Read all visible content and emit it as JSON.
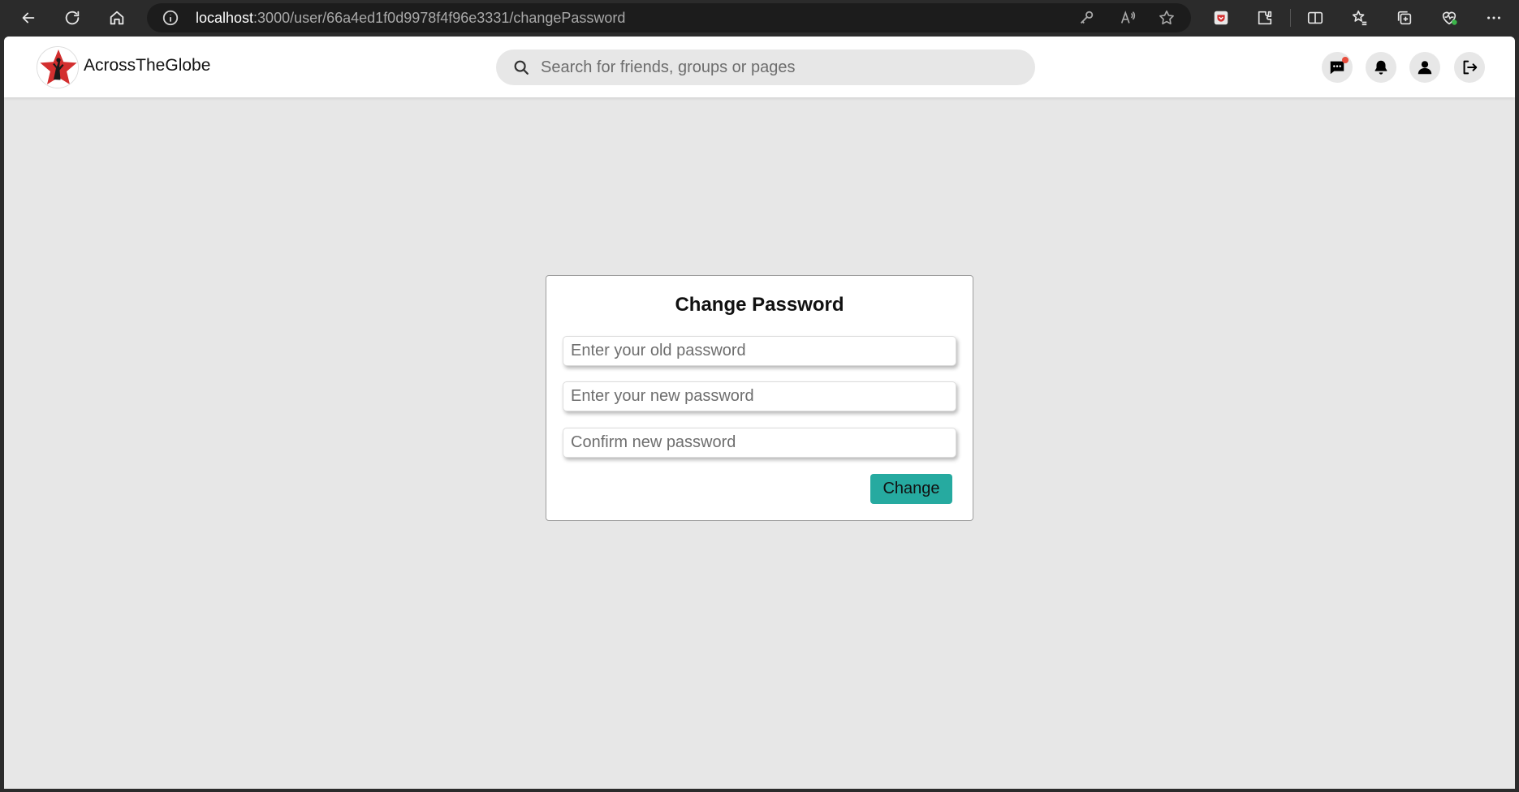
{
  "browser": {
    "url_host": "localhost",
    "url_path": ":3000/user/66a4ed1f0d9978f4f96e3331/changePassword"
  },
  "navbar": {
    "brand": "AcrossTheGlobe",
    "search_placeholder": "Search for friends, groups or pages"
  },
  "form": {
    "title": "Change Password",
    "old_password_placeholder": "Enter your old password",
    "new_password_placeholder": "Enter your new password",
    "confirm_password_placeholder": "Confirm new password",
    "submit_label": "Change"
  },
  "colors": {
    "accent": "#26aaa0",
    "page_background": "#e7e7e7",
    "logo_star": "#d32f2f"
  }
}
